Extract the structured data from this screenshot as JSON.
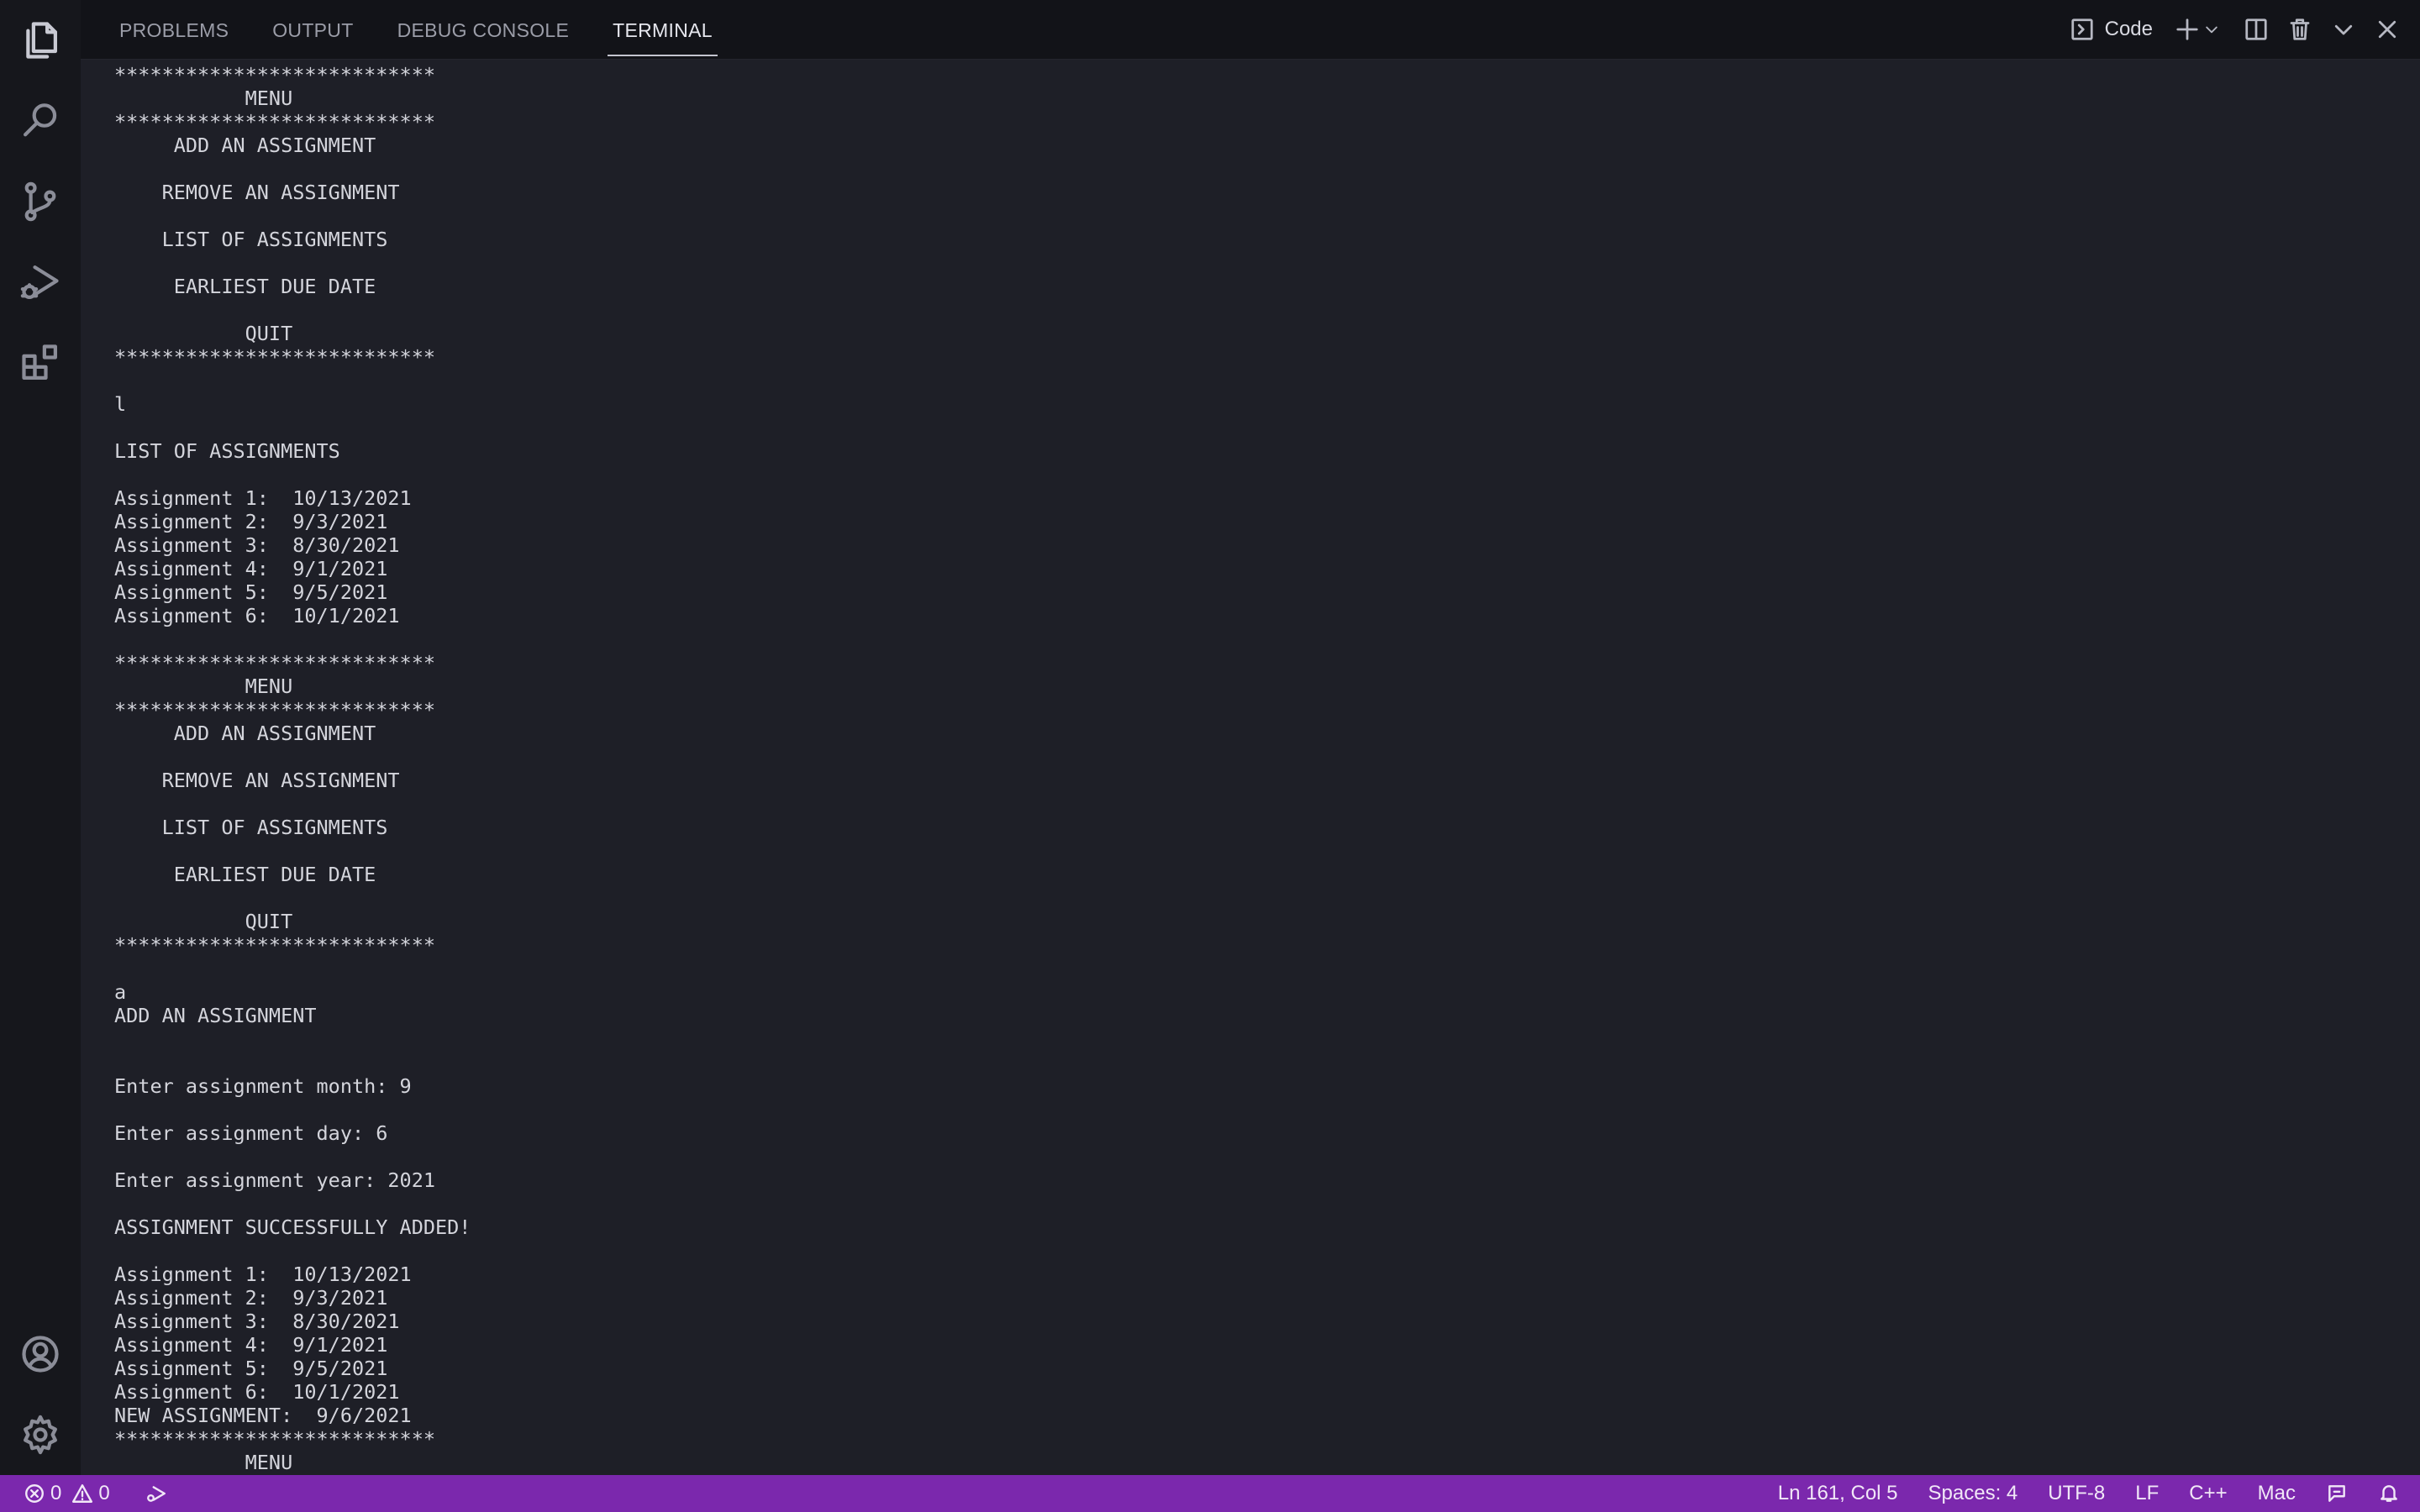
{
  "panel": {
    "tabs": [
      {
        "label": "PROBLEMS",
        "active": false
      },
      {
        "label": "OUTPUT",
        "active": false
      },
      {
        "label": "DEBUG CONSOLE",
        "active": false
      },
      {
        "label": "TERMINAL",
        "active": true
      }
    ],
    "terminal_name": "Code"
  },
  "terminal": {
    "lines": [
      "***************************",
      "           MENU",
      "***************************",
      "     ADD AN ASSIGNMENT",
      "",
      "    REMOVE AN ASSIGNMENT",
      "",
      "    LIST OF ASSIGNMENTS",
      "",
      "     EARLIEST DUE DATE",
      "",
      "           QUIT",
      "***************************",
      "",
      "l",
      "",
      "LIST OF ASSIGNMENTS",
      "",
      "Assignment 1:  10/13/2021",
      "Assignment 2:  9/3/2021",
      "Assignment 3:  8/30/2021",
      "Assignment 4:  9/1/2021",
      "Assignment 5:  9/5/2021",
      "Assignment 6:  10/1/2021",
      "",
      "***************************",
      "           MENU",
      "***************************",
      "     ADD AN ASSIGNMENT",
      "",
      "    REMOVE AN ASSIGNMENT",
      "",
      "    LIST OF ASSIGNMENTS",
      "",
      "     EARLIEST DUE DATE",
      "",
      "           QUIT",
      "***************************",
      "",
      "a",
      "ADD AN ASSIGNMENT",
      "",
      "",
      "Enter assignment month: 9",
      "",
      "Enter assignment day: 6",
      "",
      "Enter assignment year: 2021",
      "",
      "ASSIGNMENT SUCCESSFULLY ADDED!",
      "",
      "Assignment 1:  10/13/2021",
      "Assignment 2:  9/3/2021",
      "Assignment 3:  8/30/2021",
      "Assignment 4:  9/1/2021",
      "Assignment 5:  9/5/2021",
      "Assignment 6:  10/1/2021",
      "NEW ASSIGNMENT:  9/6/2021",
      "***************************",
      "           MENU"
    ]
  },
  "status_bar": {
    "errors": "0",
    "warnings": "0",
    "position": "Ln 161, Col 5",
    "spaces": "Spaces: 4",
    "encoding": "UTF-8",
    "eol": "LF",
    "language": "C++",
    "platform": "Mac"
  },
  "colors": {
    "status_bar_bg": "#7b28ad",
    "terminal_bg": "#1e1f27",
    "activity_bar_bg": "#16171c"
  },
  "icons": {
    "activity_bar": [
      "files-icon",
      "search-icon",
      "source-control-icon",
      "run-debug-icon",
      "extensions-icon",
      "account-icon",
      "gear-icon"
    ],
    "panel_actions": [
      "terminal-icon",
      "plus-icon",
      "chevron-down-icon",
      "split-icon",
      "trash-icon",
      "chevron-down-icon",
      "close-icon"
    ]
  }
}
